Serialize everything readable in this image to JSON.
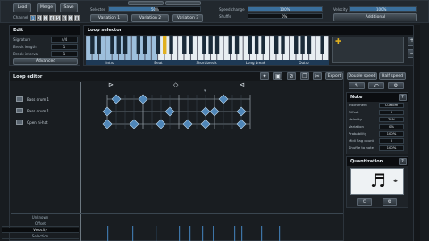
{
  "top": {
    "buttons_row": [
      {
        "label": "Load"
      },
      {
        "label": "Merge"
      },
      {
        "label": "Save"
      }
    ],
    "channel_label": "Channel",
    "channels": [
      "1",
      "2",
      "3",
      "4",
      "5",
      "6",
      "7",
      "8"
    ],
    "preset_label": "Selected",
    "preset_value": "50%",
    "variation_buttons": [
      "Variation 1",
      "Variation 2",
      "Variation 3"
    ],
    "right_labels": [
      "Speed change",
      "Shuffle"
    ],
    "right_values": [
      "100%",
      "0%"
    ],
    "velocity_label": "Velocity",
    "velocity_value": "100%",
    "additional_label": "Additional"
  },
  "edit": {
    "title": "Edit",
    "rows": [
      {
        "label": "Signature",
        "value": "4/4"
      },
      {
        "label": "Break length",
        "value": "1"
      },
      {
        "label": "Break interval",
        "value": "1"
      }
    ],
    "advanced_label": "Advanced"
  },
  "loop_selector": {
    "title": "Loop selector",
    "key_labels": [
      "Intro",
      "Beat",
      "Short break",
      "Long break",
      "Outro"
    ]
  },
  "loop_editor": {
    "title": "Loop editor",
    "toolbar_buttons": [
      "Export",
      "Double speed",
      "Half speed"
    ],
    "tracks": [
      {
        "name": "Bass drum 1"
      },
      {
        "name": "Bass drum 1"
      },
      {
        "name": "Open hi-hat"
      }
    ],
    "lane_labels": [
      "Unknown",
      "Offset",
      "Velocity",
      "Selection"
    ]
  },
  "note": {
    "title": "Note",
    "rows": [
      {
        "label": "Instrument",
        "value": "Custom"
      },
      {
        "label": "Offset",
        "value": "0"
      },
      {
        "label": "Velocity",
        "value": "78%"
      },
      {
        "label": "Variation",
        "value": "0%"
      },
      {
        "label": "Probability",
        "value": "100%"
      },
      {
        "label": "Midi flag count",
        "value": "0"
      },
      {
        "label": "Shuffle to note",
        "value": "100%"
      }
    ]
  },
  "quantization": {
    "title": "Quantization"
  },
  "colors": {
    "accent": "#3d74a6",
    "key_selected": "#e0b020",
    "panel": "#1e2328"
  }
}
